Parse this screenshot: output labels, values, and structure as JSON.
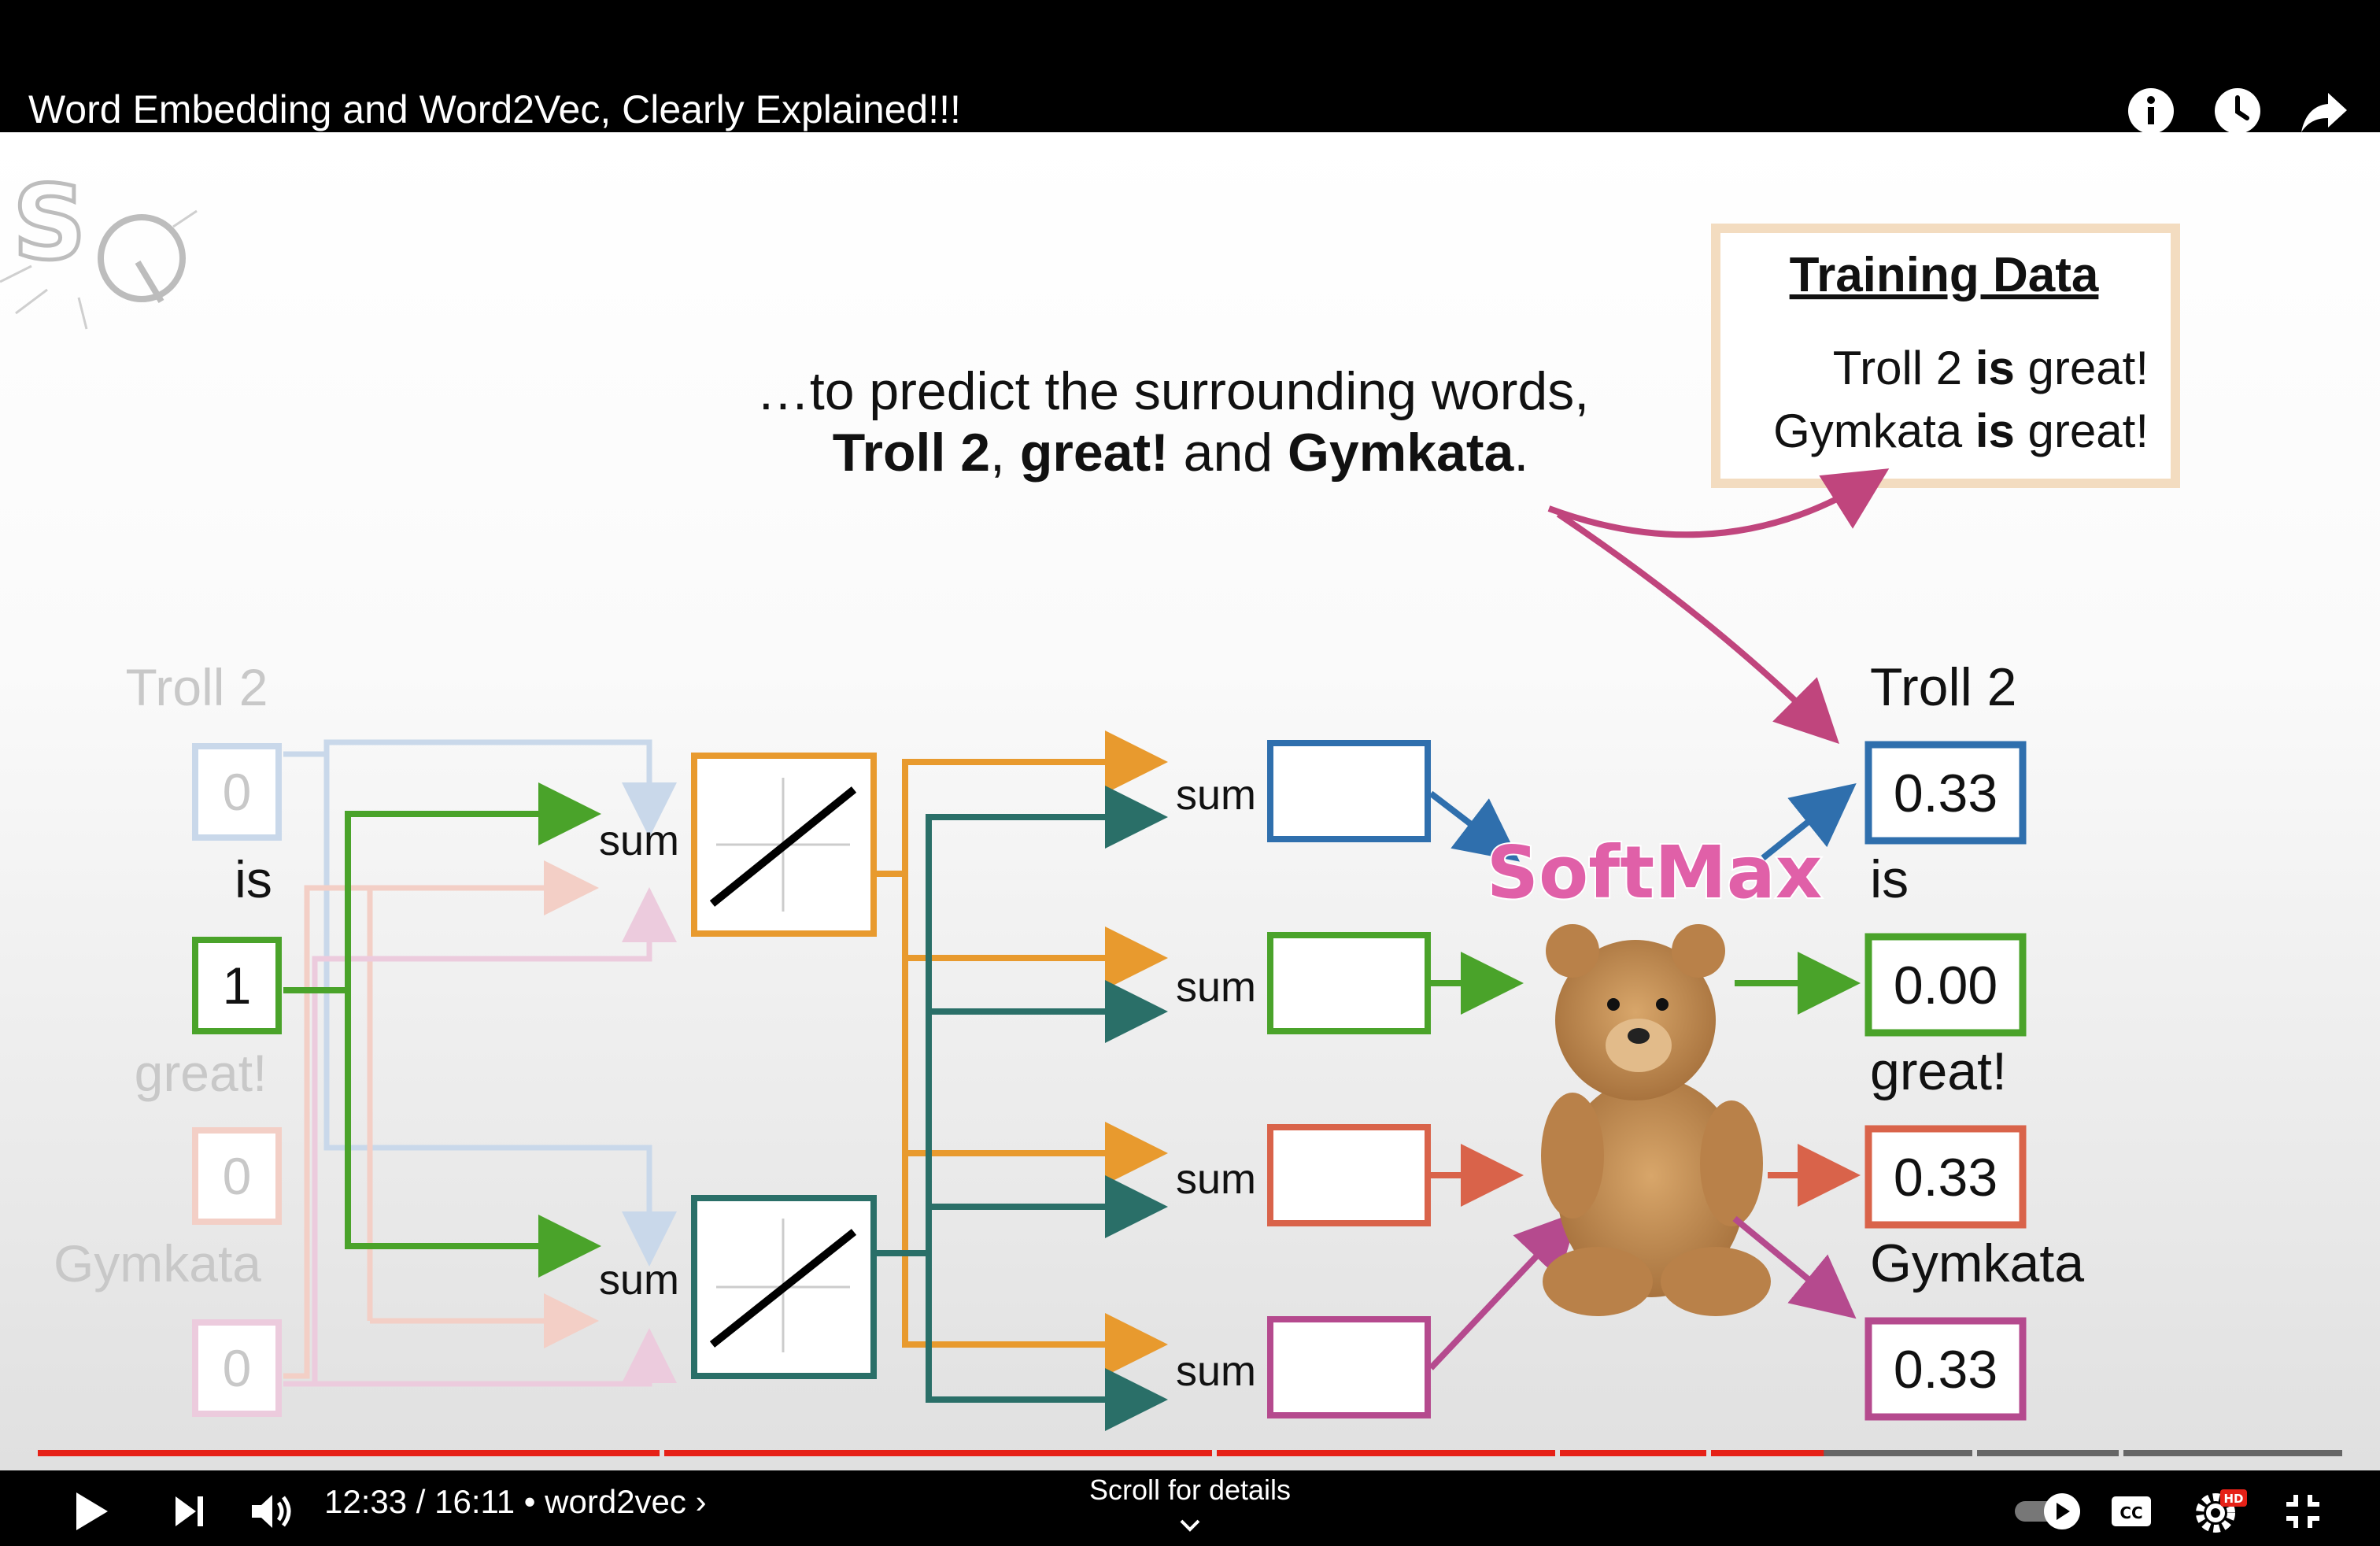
{
  "video": {
    "title": "Word Embedding and Word2Vec, Clearly Explained!!!",
    "current_time": "12:33",
    "duration": "16:11",
    "time_display": "12:33 / 16:11",
    "chapter": "• word2vec ›",
    "scroll_hint": "Scroll for details",
    "progress": 0.775,
    "hd_badge": "HD",
    "cc_label": "CC"
  },
  "top_icons": [
    "info-icon",
    "clock-icon",
    "share-icon"
  ],
  "controls": [
    "play-icon",
    "next-icon",
    "volume-icon",
    "autoplay-toggle",
    "cc-icon",
    "gear-icon",
    "exit-fullscreen-icon"
  ],
  "slide": {
    "caption_line1": "…to predict the surrounding words,",
    "caption_line2_parts": [
      "Troll 2",
      ", ",
      "great!",
      " and ",
      "Gymkata",
      "."
    ],
    "training_box": {
      "title": "Training Data",
      "line1": [
        "Troll 2 ",
        "is",
        " great!"
      ],
      "line2": [
        "Gymkata ",
        "is",
        " great!"
      ]
    },
    "inputs": [
      {
        "word": "Troll 2",
        "value": "0",
        "color": "#3a6fb0",
        "faded": true
      },
      {
        "word": "is",
        "value": "1",
        "color": "#4aa32a",
        "faded": false
      },
      {
        "word": "great!",
        "value": "0",
        "color": "#d9634a",
        "faded": true
      },
      {
        "word": "Gymkata",
        "value": "0",
        "color": "#b54a8e",
        "faded": true
      }
    ],
    "sum_label": "sum",
    "softmax_label": "SoftMax",
    "outputs": [
      {
        "word": "Troll 2",
        "value": "0.33",
        "color": "#2f6fad"
      },
      {
        "word": "is",
        "value": "0.00",
        "color": "#4aa32a"
      },
      {
        "word": "great!",
        "value": "0.33",
        "color": "#d9634a"
      },
      {
        "word": "Gymkata",
        "value": "0.33",
        "color": "#b54a8e"
      }
    ],
    "colors": {
      "orange": "#e89a2e",
      "teal": "#2a6f68",
      "magenta": "#c0457d",
      "blue": "#2f6fad",
      "green": "#4aa32a",
      "red": "#d9634a",
      "purple": "#b54a8e"
    }
  }
}
